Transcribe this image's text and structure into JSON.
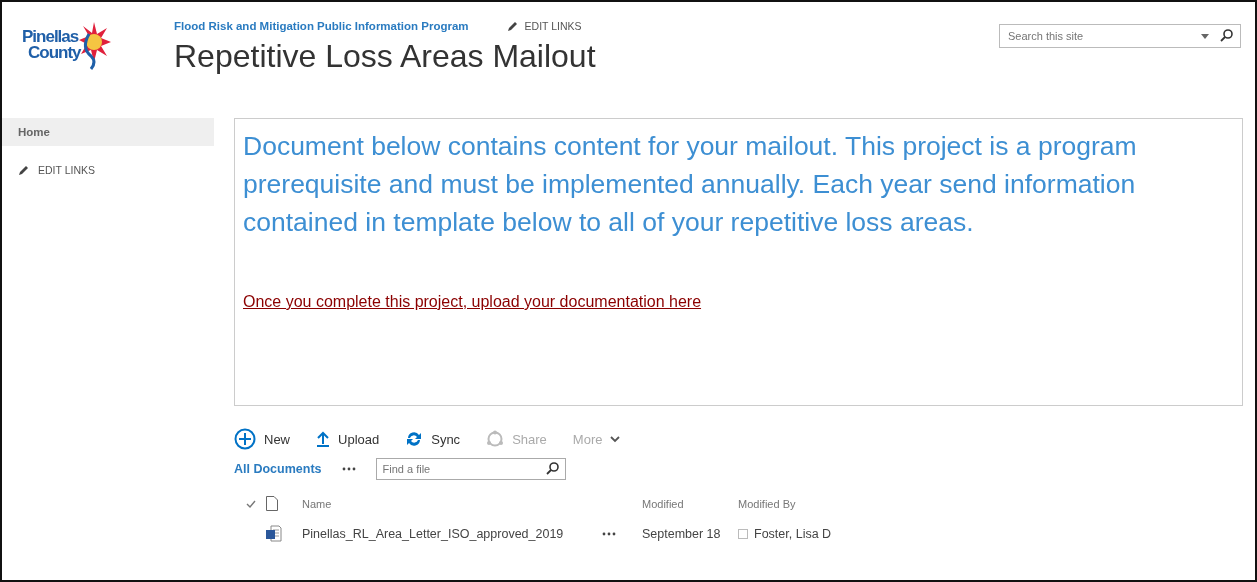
{
  "logo": {
    "line_1": "Pinellas",
    "line_2": "County"
  },
  "header": {
    "site_link": "Flood Risk and Mitigation Public Information Program",
    "edit_links": "EDIT LINKS",
    "title": "Repetitive Loss Areas Mailout"
  },
  "search": {
    "placeholder": "Search this site"
  },
  "sidebar": {
    "items": [
      {
        "label": "Home",
        "selected": true
      }
    ],
    "edit_links": "EDIT LINKS"
  },
  "content": {
    "intro": "Document below contains content for your mailout. This project is a program prerequisite and must be implemented annually. Each year send information contained in template below to all of your repetitive loss areas.",
    "link": "Once you complete this project, upload your documentation here"
  },
  "toolbar": [
    {
      "kind": "new",
      "label": "New",
      "disabled": false
    },
    {
      "kind": "upload",
      "label": "Upload",
      "disabled": false
    },
    {
      "kind": "sync",
      "label": "Sync",
      "disabled": false
    },
    {
      "kind": "share",
      "label": "Share",
      "disabled": true
    },
    {
      "kind": "more",
      "label": "More",
      "disabled": true
    }
  ],
  "view": {
    "label": "All Documents",
    "find_placeholder": "Find a file"
  },
  "table": {
    "columns": [
      "Name",
      "Modified",
      "Modified By"
    ],
    "rows": [
      {
        "name": "Pinellas_RL_Area_Letter_ISO_approved_2019",
        "modified": "September 18",
        "modified_by": "Foster, Lisa D"
      }
    ]
  }
}
